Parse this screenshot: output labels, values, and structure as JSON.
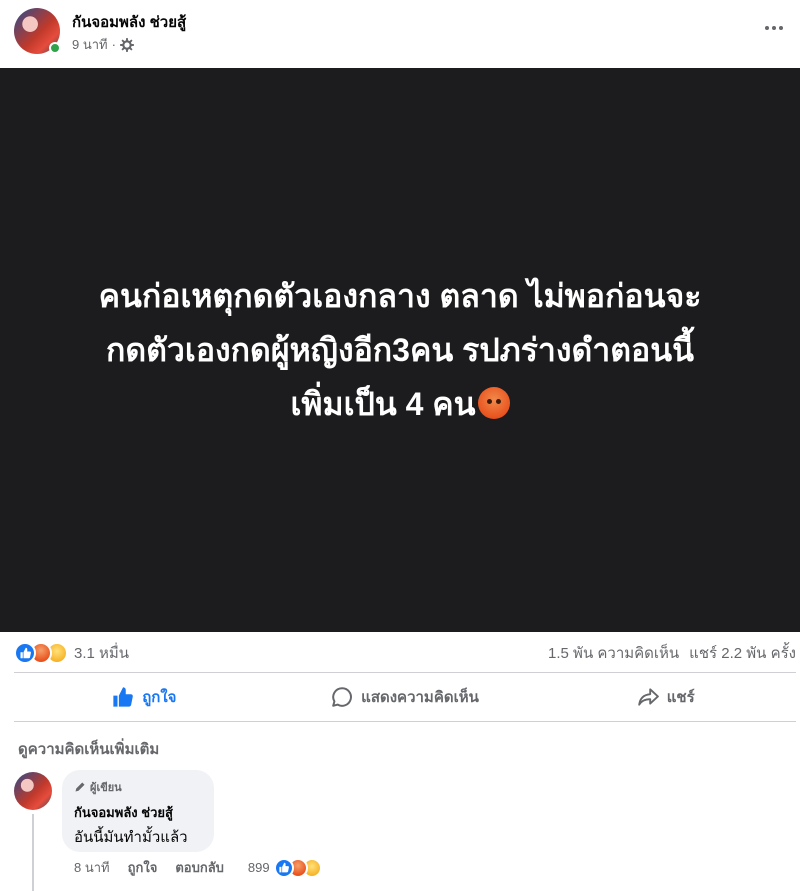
{
  "post": {
    "author": "กันจอมพลัง ช่วยสู้",
    "time": "9 นาที",
    "meta_separator": "·",
    "image_text_line1": "คนก่อเหตุกดตัวเองกลาง ตลาด ไม่พอก่อนจะ",
    "image_text_line2": "กดตัวเองกดผู้หญิงอีก3คน รปภร่างดำตอนนี้",
    "image_text_line3": "เพิ่มเป็น 4 คน",
    "icons": {
      "audience": "gear-icon",
      "more": "more-horizontal-icon",
      "emoji": "angry-face-emoji"
    }
  },
  "reactions": {
    "count": "3.1 หมื่น",
    "comments": "1.5 พัน ความคิดเห็น",
    "shares": "แชร์ 2.2 พัน ครั้ง",
    "types": [
      "like",
      "angry",
      "sad"
    ]
  },
  "actions": {
    "like": "ถูกใจ",
    "comment": "แสดงความคิดเห็น",
    "share": "แชร์"
  },
  "comments_section": {
    "view_more": "ดูความคิดเห็นเพิ่มเติม",
    "comment": {
      "badge": "ผู้เขียน",
      "author": "กันจอมพลัง ช่วยสู้",
      "text": "อันนี้มันทำมั้วแล้ว",
      "time": "8 นาที",
      "like": "ถูกใจ",
      "reply": "ตอบกลับ",
      "reaction_count": "899"
    }
  },
  "colors": {
    "accent": "#1877f2",
    "image_bg": "#1c1c1e",
    "muted": "#65676b",
    "online": "#31a24c"
  }
}
